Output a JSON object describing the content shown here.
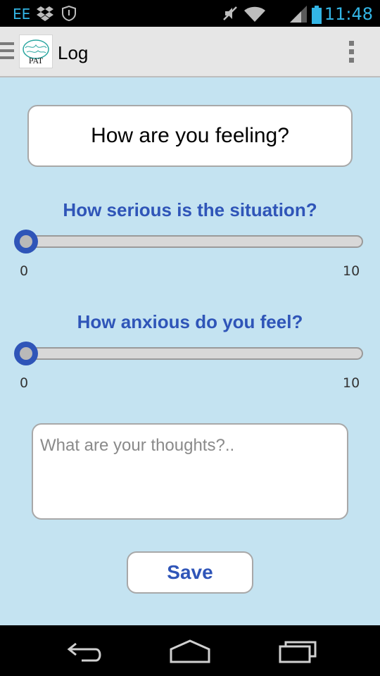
{
  "status_bar": {
    "carrier": "EE",
    "time": "11:48",
    "icons": [
      "dropbox-icon",
      "shield-icon",
      "mute-icon",
      "wifi-icon",
      "signal-icon",
      "battery-icon"
    ]
  },
  "action_bar": {
    "logo_text": "PAT",
    "title": "Log",
    "menu_icon": "drawer-icon",
    "overflow_icon": "overflow-menu-icon"
  },
  "form": {
    "question": "How are you feeling?",
    "serious": {
      "label": "How serious is the situation?",
      "min": "0",
      "max": "10",
      "value": 0
    },
    "anxious": {
      "label": "How anxious do you feel?",
      "min": "0",
      "max": "10",
      "value": 0
    },
    "thoughts_placeholder": "What are your thoughts?..",
    "thoughts_value": "",
    "save_label": "Save"
  },
  "nav_bar": {
    "icons": [
      "back-icon",
      "home-icon",
      "recents-icon"
    ]
  },
  "colors": {
    "background": "#c4e3f1",
    "accent": "#2f55b8",
    "status_text": "#33b5e5"
  }
}
